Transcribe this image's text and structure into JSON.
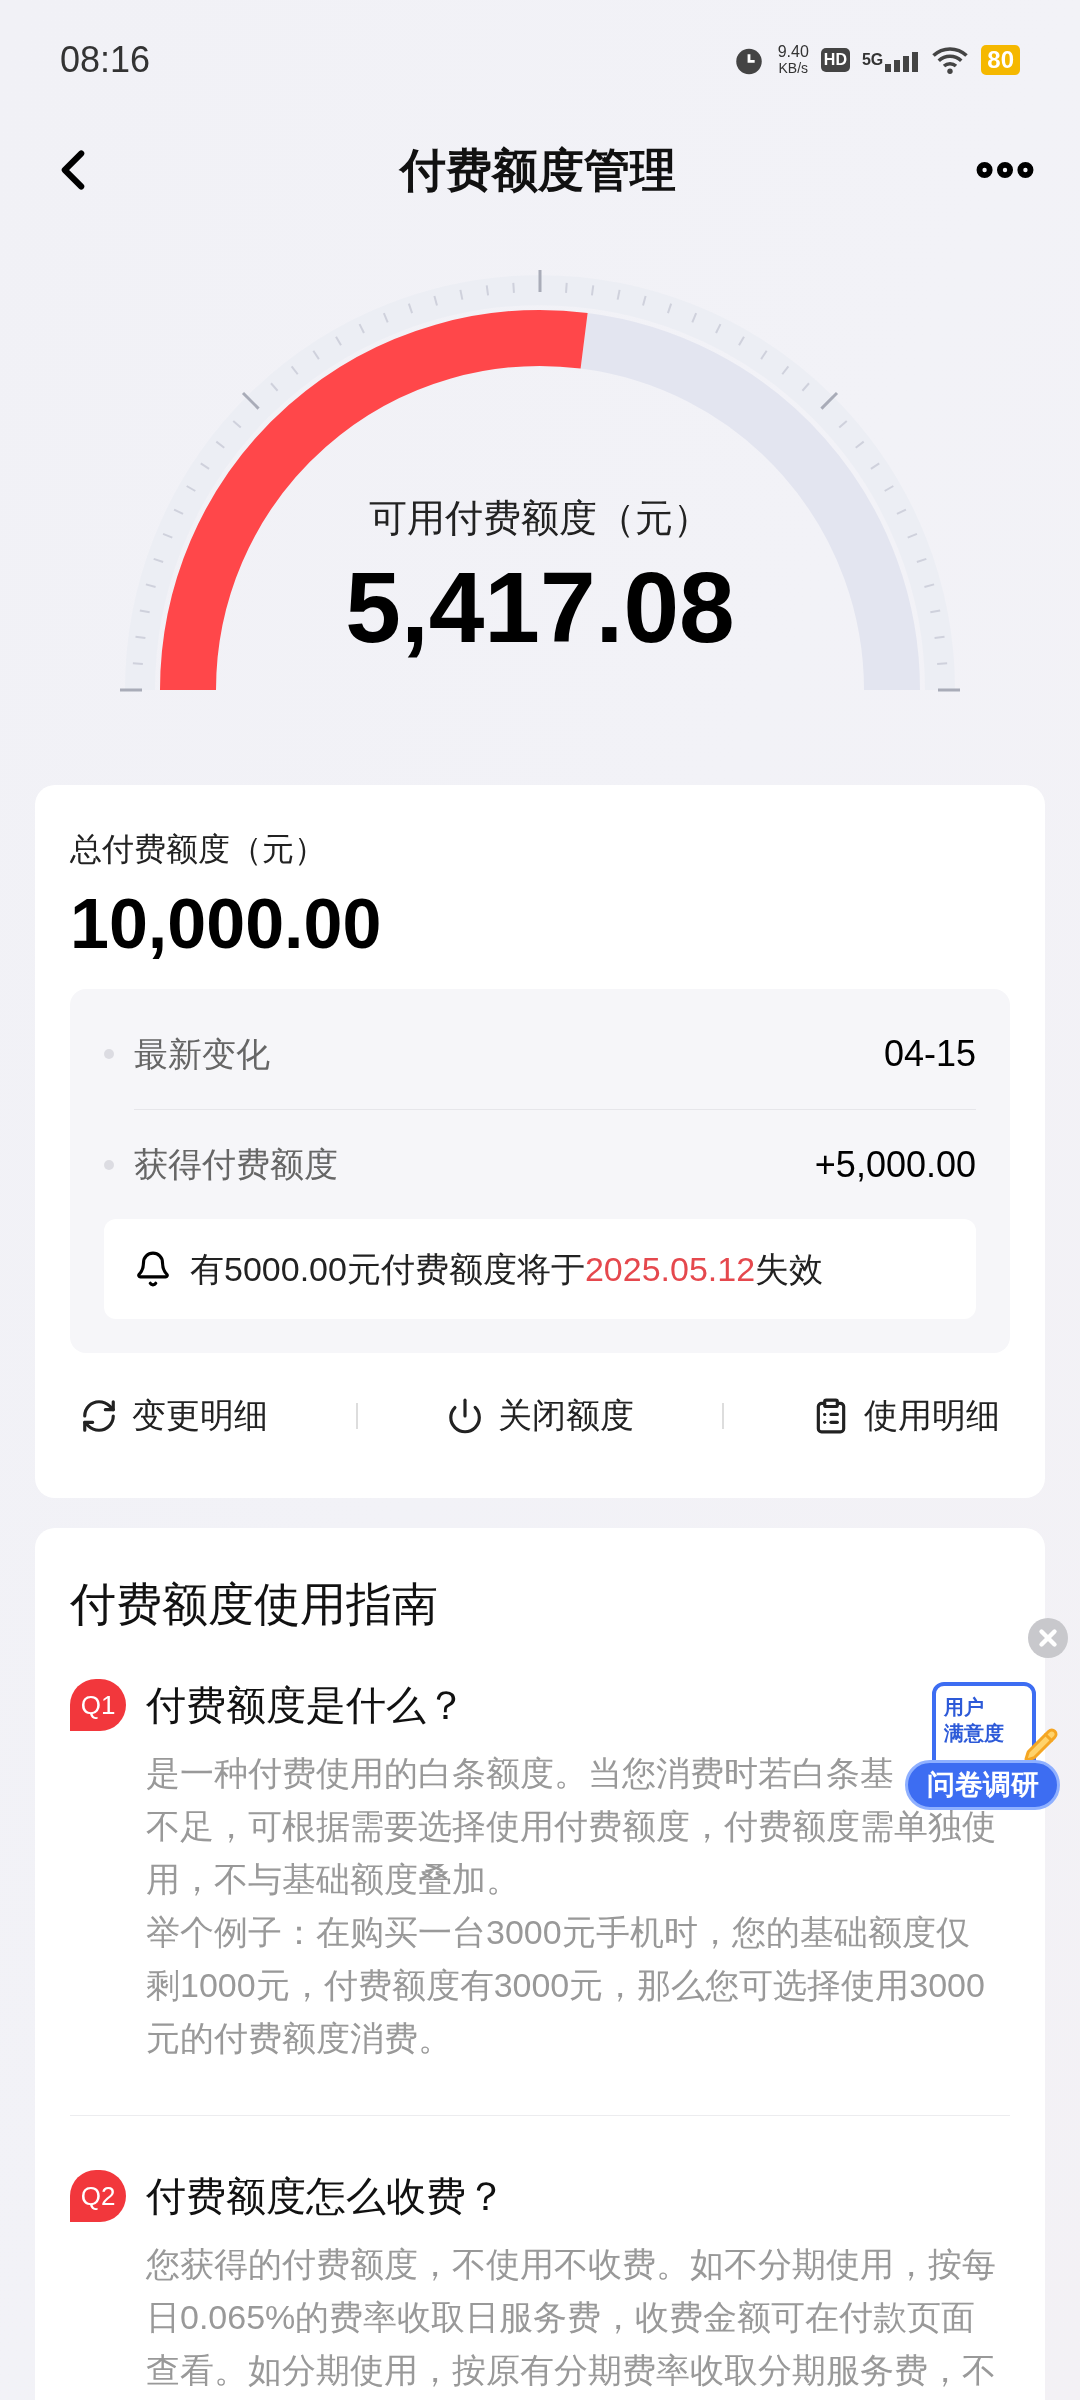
{
  "status_bar": {
    "time": "08:16",
    "net_speed": "9.40",
    "net_unit": "KB/s",
    "hd": "HD",
    "network": "5G",
    "battery": "80"
  },
  "header": {
    "title": "付费额度管理"
  },
  "gauge": {
    "label": "可用付费额度（元）",
    "value": "5,417.08"
  },
  "total_card": {
    "label": "总付费额度（元）",
    "value": "10,000.00",
    "details": [
      {
        "label": "最新变化",
        "value": "04-15"
      },
      {
        "label": "获得付费额度",
        "value": "+5,000.00"
      }
    ],
    "notice": {
      "before": "有5000.00元付费额度将于",
      "date": "2025.05.12",
      "after": "失效"
    },
    "actions": [
      {
        "kind": "refresh",
        "label": "变更明细"
      },
      {
        "kind": "power",
        "label": "关闭额度"
      },
      {
        "kind": "clipboard",
        "label": "使用明细"
      }
    ]
  },
  "guide": {
    "title": "付费额度使用指南",
    "items": [
      {
        "badge": "Q1",
        "question": "付费额度是什么？",
        "lines": [
          "是一种付费使用的白条额度。当您消费时若白条基",
          "不足，可根据需要选择使用付费额度，付费额度需单独使",
          "用，不与基础额度叠加。",
          "举个例子：在购买一台3000元手机时，您的基础额度仅",
          "剩1000元，付费额度有3000元，那么您可选择使用3000",
          "元的付费额度消费。"
        ]
      },
      {
        "badge": "Q2",
        "question": "付费额度怎么收费？",
        "lines": [
          "您获得的付费额度，不使用不收费。如不分期使用，按每",
          "日0.065%的费率收取日服务费，收费金额可在付款页面",
          "查看。如分期使用，按原有分期费率收取分期服务费，不"
        ]
      }
    ]
  },
  "survey_widget": {
    "lines": [
      "用户",
      "满意度"
    ],
    "button": "问卷调研"
  }
}
